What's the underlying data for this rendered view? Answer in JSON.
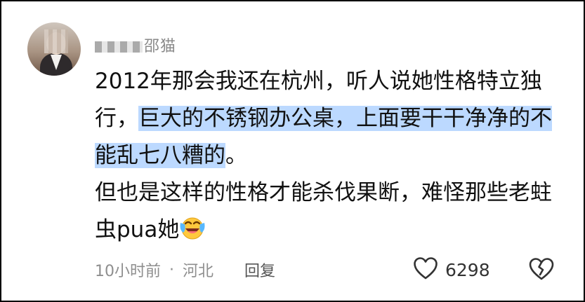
{
  "comment": {
    "username_visible": "邵猫",
    "text_part1": "2012年那会我还在杭州，听人说她性格特立独行，",
    "text_highlighted": "巨大的不锈钢办公桌，上面要干干净净的不能乱七八糟的",
    "text_part2": "。",
    "text_part3": "但也是这样的性格才能杀伐果断，难怪那些老蛀虫pua她",
    "emoji": "laughing-tears-emoji",
    "highlight_color": "#bcd9ff"
  },
  "meta": {
    "time": "10小时前",
    "separator": "·",
    "location": "河北",
    "reply_label": "回复"
  },
  "actions": {
    "like_icon": "heart-icon",
    "like_count": "6298",
    "dislike_icon": "broken-heart-icon"
  }
}
